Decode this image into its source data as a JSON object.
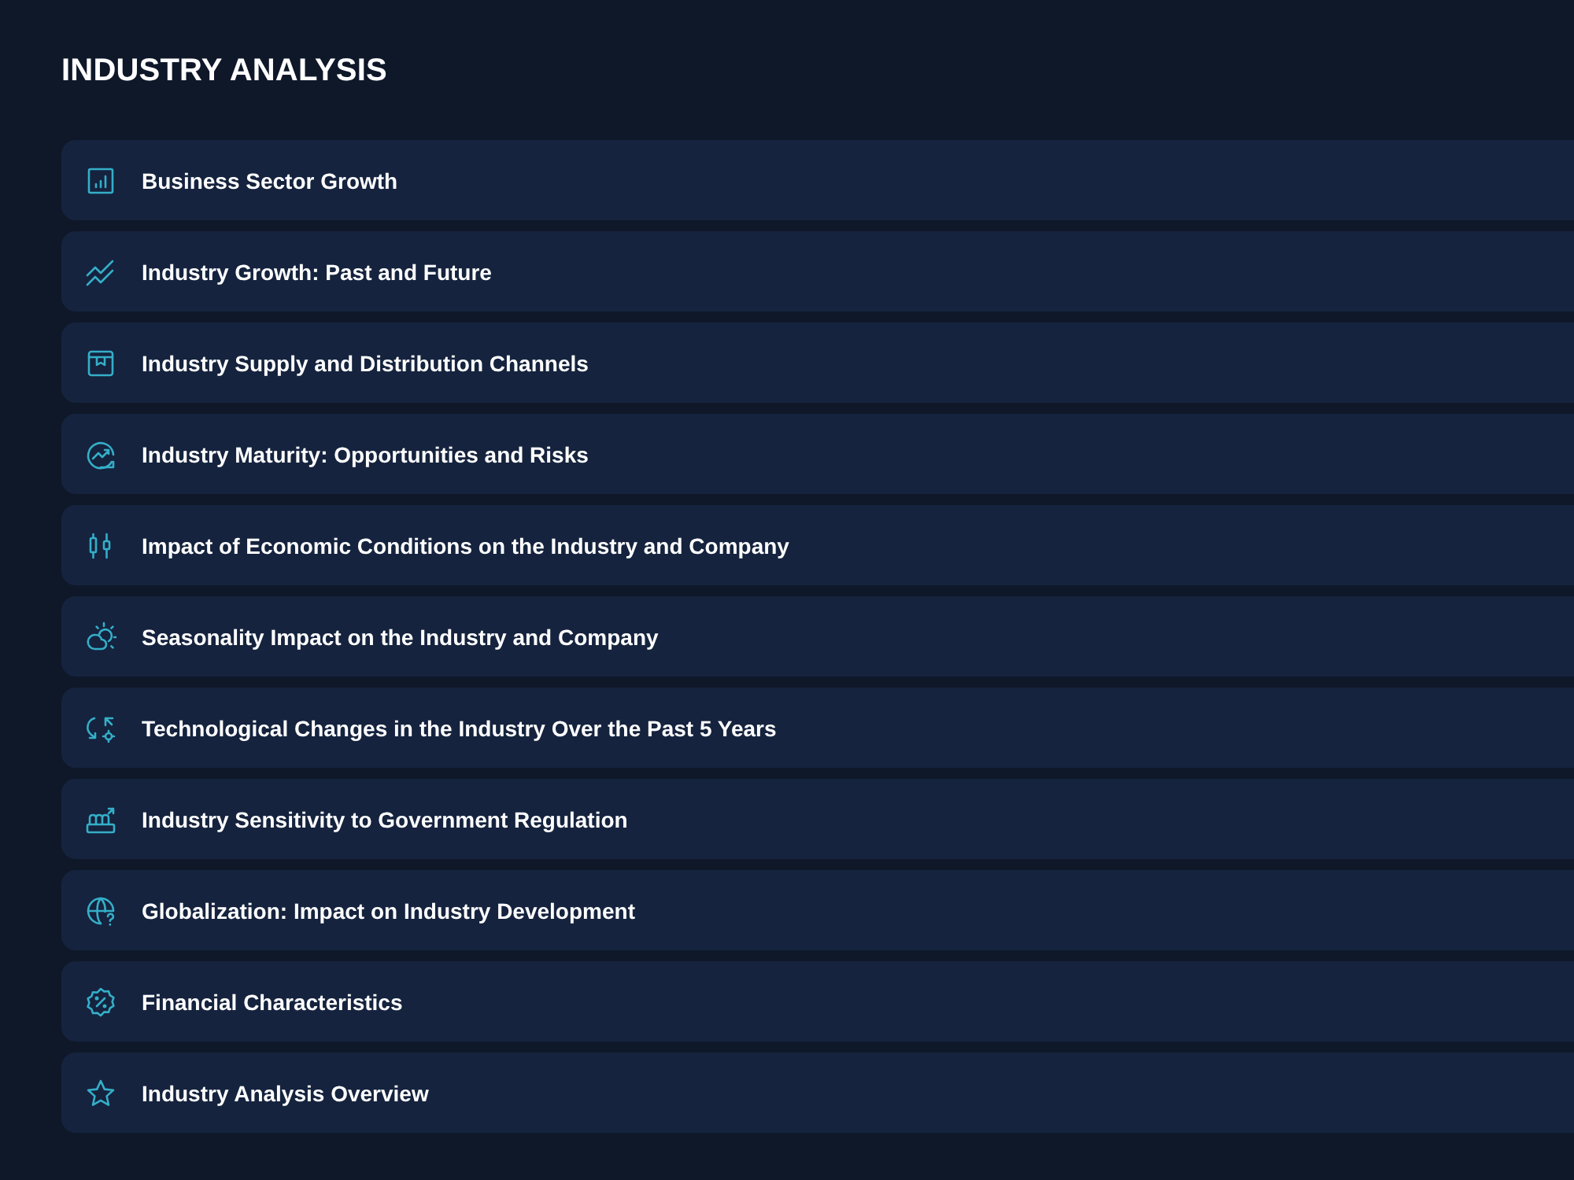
{
  "title": "INDUSTRY ANALYSIS",
  "items": [
    {
      "label": "Business Sector Growth"
    },
    {
      "label": "Industry Growth: Past and Future"
    },
    {
      "label": "Industry Supply and Distribution Channels"
    },
    {
      "label": "Industry Maturity: Opportunities and Risks"
    },
    {
      "label": "Impact of Economic Conditions on the Industry and Company"
    },
    {
      "label": "Seasonality Impact on the Industry and Company"
    },
    {
      "label": "Technological Changes in the Industry Over the Past 5 Years"
    },
    {
      "label": "Industry Sensitivity to Government Regulation"
    },
    {
      "label": "Globalization: Impact on Industry Development"
    },
    {
      "label": "Financial Characteristics"
    },
    {
      "label": "Industry Analysis Overview"
    }
  ]
}
